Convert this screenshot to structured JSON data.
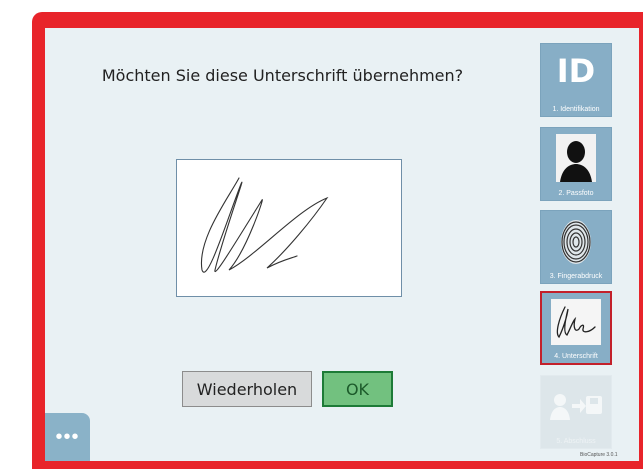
{
  "dialog": {
    "question": "Möchten Sie diese Unterschrift übernehmen?"
  },
  "buttons": {
    "retry_label": "Wiederholen",
    "ok_label": "OK"
  },
  "menu": {
    "more_label": "•••"
  },
  "steps": [
    {
      "label": "1. Identifikation",
      "icon": "id-icon",
      "icon_text": "ID"
    },
    {
      "label": "2. Passfoto",
      "icon": "passport-photo-icon"
    },
    {
      "label": "3. Fingerabdruck",
      "icon": "fingerprint-icon"
    },
    {
      "label": "4. Unterschrift",
      "icon": "signature-icon",
      "active": true
    },
    {
      "label": "5. Abschluss",
      "icon": "transfer-save-icon",
      "disabled": true
    }
  ],
  "footer": {
    "version": "BioCapture 3.0.1"
  },
  "colors": {
    "frame": "#e8242a",
    "panel": "#e9f1f4",
    "step": "#87aec6",
    "ok": "#72c17f",
    "active_border": "#c3202a"
  }
}
